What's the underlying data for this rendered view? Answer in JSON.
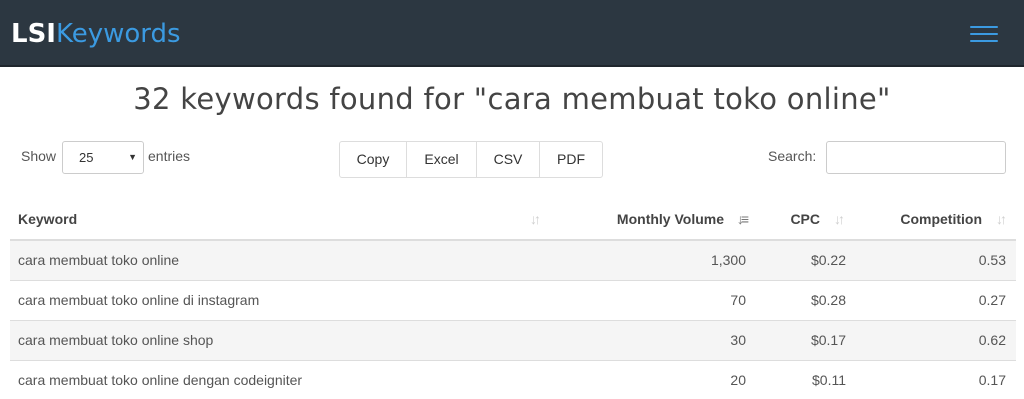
{
  "navbar": {
    "logo_prefix": "LSI",
    "logo_suffix": "Keywords",
    "menu_icon": "hamburger-menu-icon"
  },
  "page_title": "32 keywords found for \"cara membuat toko online\"",
  "controls": {
    "show_label": "Show",
    "page_length_value": "25",
    "entries_label": "entries",
    "export_buttons": [
      "Copy",
      "Excel",
      "CSV",
      "PDF"
    ],
    "search_label": "Search:",
    "search_value": ""
  },
  "table": {
    "columns": [
      {
        "label": "Keyword",
        "sort_state": "unsorted"
      },
      {
        "label": "Monthly Volume",
        "sort_state": "descending"
      },
      {
        "label": "CPC",
        "sort_state": "unsorted"
      },
      {
        "label": "Competition",
        "sort_state": "unsorted"
      }
    ],
    "rows": [
      {
        "keyword": "cara membuat toko online",
        "volume": "1,300",
        "cpc": "$0.22",
        "competition": "0.53"
      },
      {
        "keyword": "cara membuat toko online di instagram",
        "volume": "70",
        "cpc": "$0.28",
        "competition": "0.27"
      },
      {
        "keyword": "cara membuat toko online shop",
        "volume": "30",
        "cpc": "$0.17",
        "competition": "0.62"
      },
      {
        "keyword": "cara membuat toko online dengan codeigniter",
        "volume": "20",
        "cpc": "$0.11",
        "competition": "0.17"
      }
    ]
  },
  "colors": {
    "navbar_bg": "#2c3741",
    "accent": "#3b9ae1",
    "striped_row": "#f5f5f5"
  }
}
